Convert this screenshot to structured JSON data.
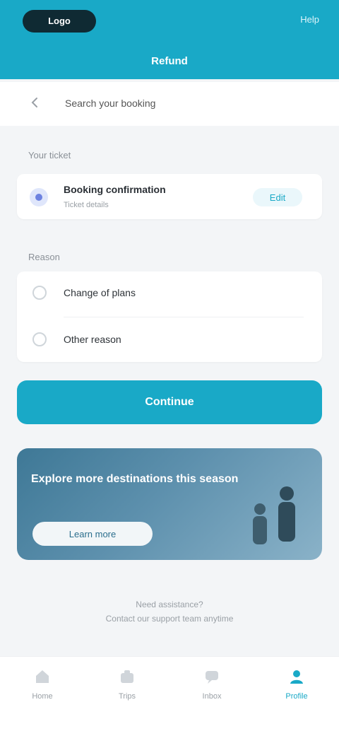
{
  "header": {
    "app_pill": "Logo",
    "right_text": "Help",
    "title": "Refund"
  },
  "search": {
    "text": "Search your booking"
  },
  "sections": {
    "ticket_label": "Your ticket",
    "reason_label": "Reason"
  },
  "ticket": {
    "title": "Booking confirmation",
    "subtitle": "Ticket details",
    "change_label": "Edit"
  },
  "options": [
    {
      "label": "Change of plans"
    },
    {
      "label": "Other reason"
    }
  ],
  "primary_button": {
    "label": "Continue"
  },
  "banner": {
    "title": "Explore more destinations this season",
    "button": "Learn more"
  },
  "footer": {
    "line1": "Need assistance?",
    "line2": "Contact our support team anytime"
  },
  "tabs": [
    {
      "label": "Home",
      "icon": "home-icon"
    },
    {
      "label": "Trips",
      "icon": "briefcase-icon"
    },
    {
      "label": "Inbox",
      "icon": "chat-icon"
    },
    {
      "label": "Profile",
      "icon": "person-icon"
    }
  ],
  "colors": {
    "accent": "#19a9c7",
    "background": "#f3f5f7"
  }
}
